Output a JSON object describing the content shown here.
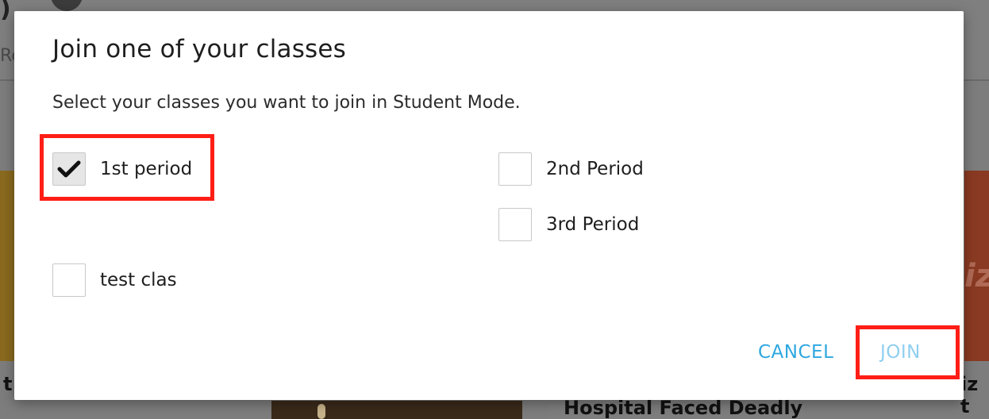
{
  "background": {
    "header_glyph": ")",
    "header_tab_fragment": "Re",
    "card_left_text": "t",
    "card_right_text": "iz t",
    "card_right_watermark": "iz",
    "headline": "Hospital Faced Deadly"
  },
  "dialog": {
    "title": "Join one of your classes",
    "subtitle": "Select your classes you want to join in Student Mode.",
    "classes": [
      {
        "label": "1st period",
        "checked": true
      },
      {
        "label": "2nd Period",
        "checked": false
      },
      {
        "label": "3rd Period",
        "checked": false
      },
      {
        "label": "test clas",
        "checked": false
      }
    ],
    "cancel_label": "CANCEL",
    "join_label": "JOIN"
  },
  "colors": {
    "accent": "#2ea7e0",
    "join_disabled": "#8fcff0",
    "highlight": "#ff1e16"
  }
}
